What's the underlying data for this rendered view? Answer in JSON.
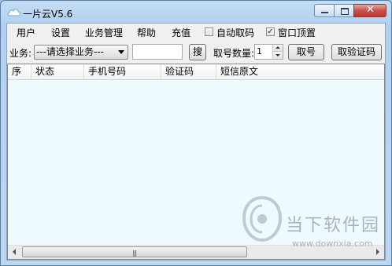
{
  "window": {
    "title": "一片云V5.6"
  },
  "menu": [
    {
      "label": "用户"
    },
    {
      "label": "设置"
    },
    {
      "label": "业务管理"
    },
    {
      "label": "帮助"
    },
    {
      "label": "充值"
    }
  ],
  "options": {
    "auto_fetch_label": "自动取码",
    "auto_fetch_checked": false,
    "on_top_label": "窗口顶置",
    "on_top_checked": true
  },
  "toolbar": {
    "service_label": "业务:",
    "service_select": "---请选择业务---",
    "search_value": "",
    "search_button": "搜",
    "quantity_label": "取号数量:",
    "quantity_value": "1",
    "get_number_button": "取号",
    "get_code_button": "取验证码"
  },
  "table": {
    "columns": [
      "序",
      "状态",
      "手机号码",
      "验证码",
      "短信原文"
    ],
    "rows": []
  },
  "watermark": {
    "text": "当下软件园",
    "url": "www.downxia.com"
  }
}
